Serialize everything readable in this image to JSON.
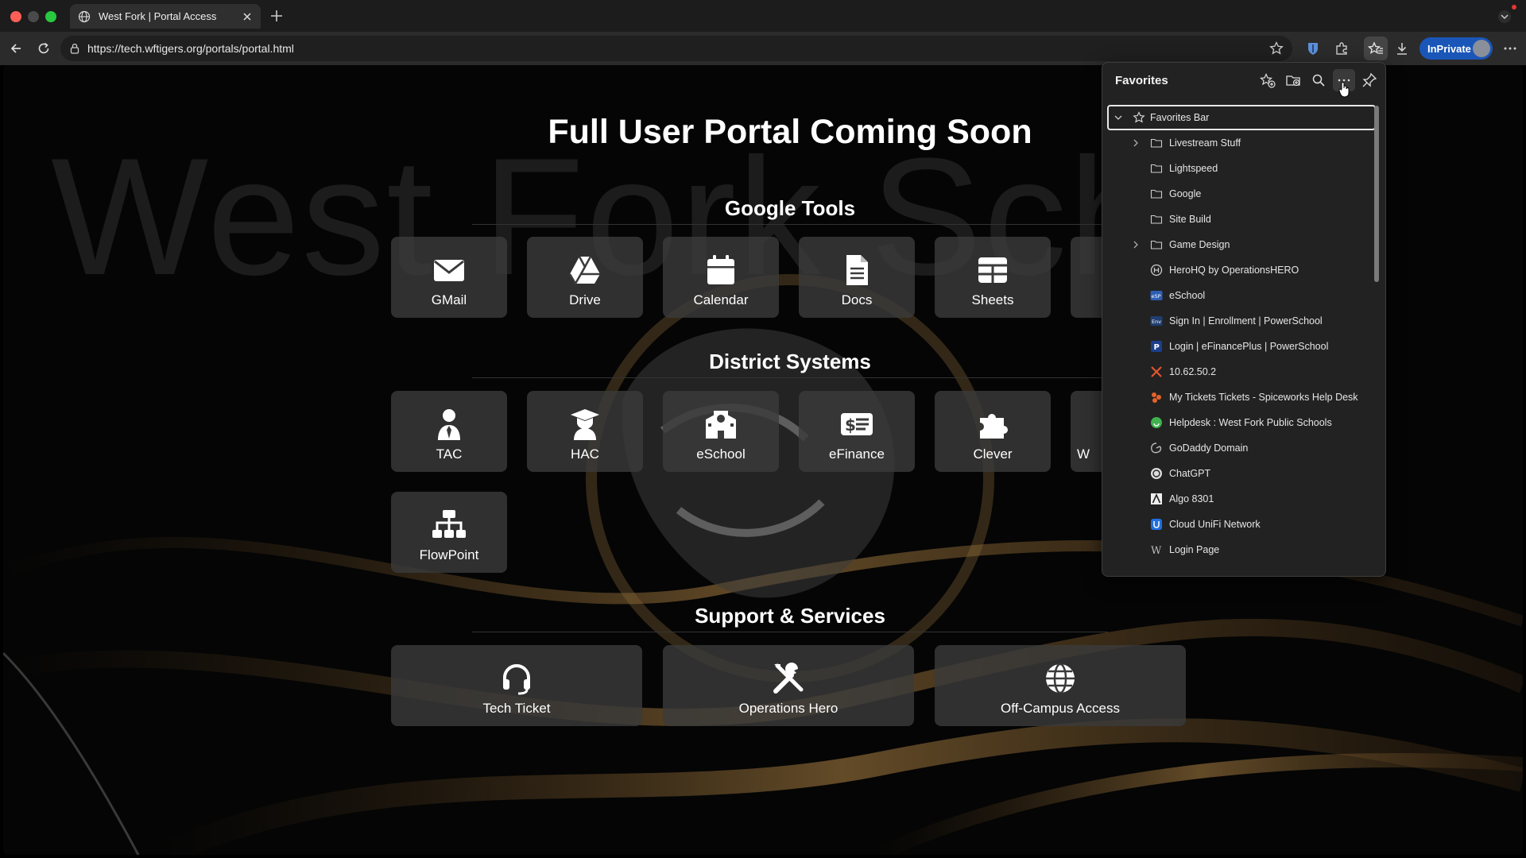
{
  "browser": {
    "tab_title": "West Fork | Portal Access",
    "url": "https://tech.wftigers.org/portals/portal.html",
    "inprivate_label": "InPrivate"
  },
  "page": {
    "watermark": "West Fork Scho",
    "title": "Full User Portal Coming Soon",
    "sections": {
      "google": {
        "title": "Google Tools",
        "tiles": [
          "GMail",
          "Drive",
          "Calendar",
          "Docs",
          "Sheets"
        ]
      },
      "district": {
        "title": "District Systems",
        "tiles": [
          "TAC",
          "HAC",
          "eSchool",
          "eFinance",
          "Clever",
          "W",
          "FlowPoint"
        ]
      },
      "support": {
        "title": "Support & Services",
        "tiles": [
          "Tech Ticket",
          "Operations Hero",
          "Off-Campus Access"
        ]
      }
    }
  },
  "favorites": {
    "header": "Favorites",
    "root": "Favorites Bar",
    "items": [
      {
        "label": "Livestream Stuff",
        "icon": "folder-icon",
        "expandable": true
      },
      {
        "label": "Lightspeed",
        "icon": "folder-icon",
        "expandable": false
      },
      {
        "label": "Google",
        "icon": "folder-icon",
        "expandable": false
      },
      {
        "label": "Site Build",
        "icon": "folder-icon",
        "expandable": false
      },
      {
        "label": "Game Design",
        "icon": "folder-icon",
        "expandable": true
      },
      {
        "label": "HeroHQ by OperationsHERO",
        "icon": "herohq-icon"
      },
      {
        "label": "eSchool",
        "icon": "eschool-icon"
      },
      {
        "label": "Sign In | Enrollment | PowerSchool",
        "icon": "enrollment-icon"
      },
      {
        "label": "Login | eFinancePlus | PowerSchool",
        "icon": "powerschool-icon"
      },
      {
        "label": "10.62.50.2",
        "icon": "x-icon"
      },
      {
        "label": "My Tickets Tickets - Spiceworks Help Desk",
        "icon": "spiceworks-icon"
      },
      {
        "label": "Helpdesk : West Fork Public Schools",
        "icon": "helpdesk-icon"
      },
      {
        "label": "GoDaddy Domain",
        "icon": "godaddy-icon"
      },
      {
        "label": "ChatGPT",
        "icon": "chatgpt-icon"
      },
      {
        "label": "Algo 8301",
        "icon": "algo-icon"
      },
      {
        "label": "Cloud UniFi Network",
        "icon": "unifi-icon"
      },
      {
        "label": "Login Page",
        "icon": "wordpress-icon"
      }
    ]
  },
  "colors": {
    "page_bg": "#050505",
    "tile_bg": "#3a3a3a",
    "accent_gold": "#b08444",
    "inprivate_blue": "#1a56b8"
  }
}
